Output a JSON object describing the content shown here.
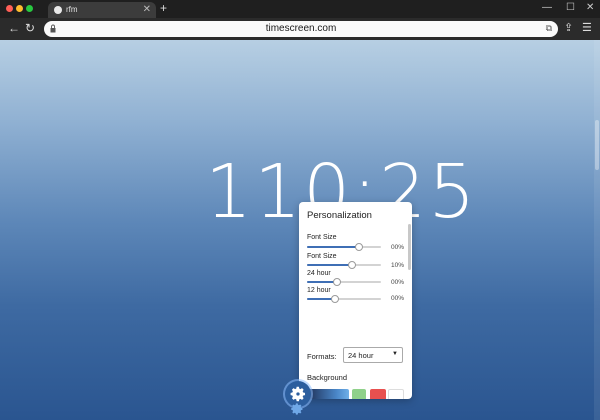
{
  "browser": {
    "tab_title": "rfm",
    "url": "timescreen.com"
  },
  "clock": {
    "time": "110:25"
  },
  "personalization": {
    "title": "Personalization",
    "sliders": [
      {
        "label": "Font Size",
        "value_text": "00%",
        "level": 0.7
      },
      {
        "label": "Font Size",
        "value_text": "10%",
        "level": 0.61
      },
      {
        "label": "24 hour",
        "value_text": "00%",
        "level": 0.4
      },
      {
        "label": "12 hour",
        "value_text": "00%",
        "level": 0.38
      }
    ],
    "formats_label": "Formats:",
    "formats_value": "24 hour",
    "background_label": "Background",
    "swatches": [
      "gradient-blue",
      "#8fd18a",
      "#e8504f",
      "#ffffff"
    ]
  },
  "colors": {
    "accent": "#3f6fb5",
    "page_gradient_top": "#b7cfe3",
    "page_gradient_bottom": "#2a5590"
  },
  "icons": {
    "settings": "gear-icon"
  }
}
